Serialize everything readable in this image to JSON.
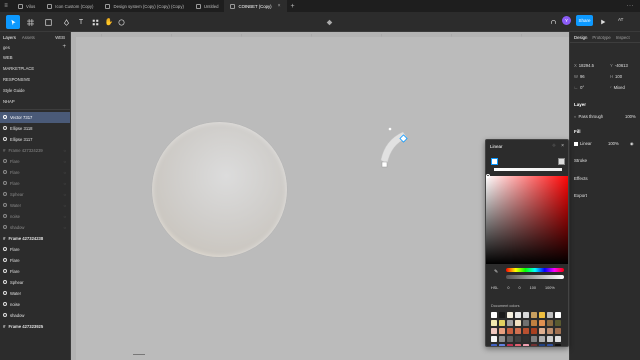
{
  "tabs": [
    {
      "label": "Vilos",
      "active": false
    },
    {
      "label": "Icon Custom (Copy)",
      "active": false
    },
    {
      "label": "Design system (Copy) (Copy) (Copy)",
      "active": false
    },
    {
      "label": "Untitled",
      "active": false
    },
    {
      "label": "COINBET (Copy)",
      "active": true
    }
  ],
  "toolbar": {
    "share_label": "Share",
    "avatar_initial": "Y",
    "zoom_label": "AT"
  },
  "left_panel": {
    "tab_layers": "Layers",
    "tab_assets": "Assets",
    "page_label": "WEB",
    "pages_header": "ges",
    "pages": [
      "WEB",
      "MARKETPLACE",
      "RESPONSIVE",
      "Style Guide",
      "NHAP"
    ],
    "layers": [
      {
        "label": "Vector 7317",
        "kind": "sel"
      },
      {
        "label": "Ellipse 3118",
        "kind": "normal"
      },
      {
        "label": "Ellipse 3117",
        "kind": "normal"
      },
      {
        "label": "Frame 427324239",
        "kind": "dim-frame"
      },
      {
        "label": "Flare",
        "kind": "dim"
      },
      {
        "label": "Flare",
        "kind": "dim"
      },
      {
        "label": "Flare",
        "kind": "dim"
      },
      {
        "label": "Sphear",
        "kind": "dim"
      },
      {
        "label": "Water",
        "kind": "dim"
      },
      {
        "label": "noise",
        "kind": "dim"
      },
      {
        "label": "shadow",
        "kind": "dim"
      },
      {
        "label": "Frame 427324238",
        "kind": "bold-frame"
      },
      {
        "label": "Flare",
        "kind": "normal"
      },
      {
        "label": "Flare",
        "kind": "normal"
      },
      {
        "label": "Flare",
        "kind": "normal"
      },
      {
        "label": "Sphear",
        "kind": "normal"
      },
      {
        "label": "Water",
        "kind": "normal"
      },
      {
        "label": "noise",
        "kind": "normal"
      },
      {
        "label": "shadow",
        "kind": "normal"
      },
      {
        "label": "Frame 427323925",
        "kind": "bold-frame"
      }
    ]
  },
  "right_panel": {
    "tab_design": "Design",
    "tab_prototype": "Prototype",
    "tab_inspect": "Inspect",
    "x": "18294.5",
    "y": "-40613",
    "w": "96",
    "h": "100",
    "rotation": "0°",
    "radius": "Mixed",
    "layer_title": "Layer",
    "blend": "Pass through",
    "opacity": "100%",
    "fill_title": "Fill",
    "fill_type": "Linear",
    "fill_opacity": "100%",
    "stroke_title": "Stroke",
    "effects_title": "Effects",
    "export_title": "Export"
  },
  "picker": {
    "type": "Linear",
    "mode": "HSL",
    "h": "0",
    "s": "0",
    "l": "100",
    "a": "100%",
    "doc_colors_label": "Document colors",
    "doc_colors": [
      "#ffffff",
      "#1a1a1a",
      "#f5f0e0",
      "#e8e8e8",
      "#d9d9d9",
      "#c8a060",
      "#f0c040",
      "#bdbdbd",
      "#ffffff",
      "#f2e8b0",
      "#e0d060",
      "#a0a0a0",
      "#f0e0c0",
      "#707070",
      "#c08040",
      "#e09050",
      "#8a6a40",
      "#5a5a30",
      "#f0c8c0",
      "#e8a080",
      "#c86040",
      "#d07050",
      "#b85030",
      "#a84020",
      "#e0b090",
      "#c09070",
      "#a07050",
      "#f5f5f5",
      "#909090",
      "#606060",
      "#404040",
      "#303030",
      "#808080",
      "#b0b0b0",
      "#d0d0d0",
      "#e0e0e0",
      "#4060c0",
      "#6080e0",
      "#c03050",
      "#e06070",
      "#f0a0b0",
      "#703030",
      "#204080",
      "#3050a0",
      "#101010"
    ]
  }
}
